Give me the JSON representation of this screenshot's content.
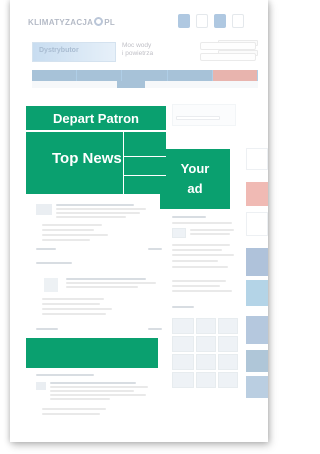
{
  "overlays": {
    "depart_patron": "Depart Patron",
    "top_news": "Top News",
    "your_ad_line1": "Your",
    "your_ad_line2": "ad"
  },
  "header": {
    "logo": "KLIMATYZACJA",
    "logo_suffix": "PL"
  },
  "banner": {
    "image_text": "Dystrybutor",
    "tagline_line1": "Moc wody",
    "tagline_line2": "i powietrza"
  },
  "nav": {
    "items": [
      "",
      "",
      "",
      "",
      ""
    ]
  },
  "colors": {
    "overlay_green": "#0aa06f",
    "nav_blue": "#1a5f9a",
    "nav_accent": "#c23a2c"
  }
}
